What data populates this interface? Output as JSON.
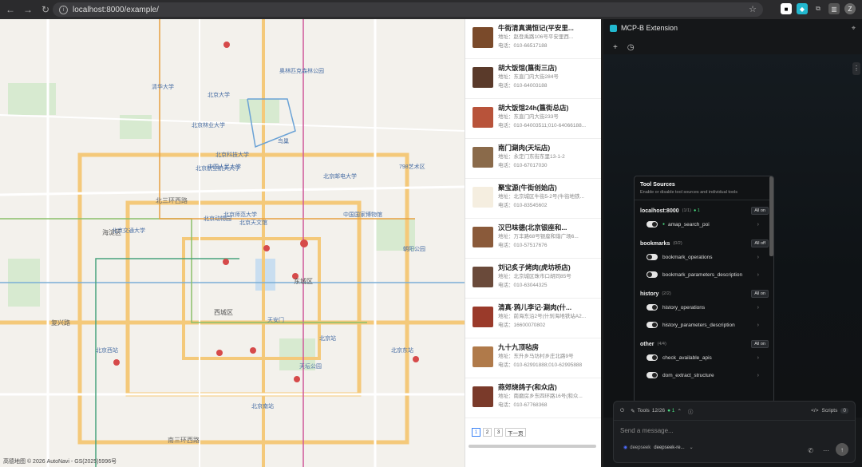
{
  "browser": {
    "url": "localhost:8000/example/",
    "profile_initial": "Z"
  },
  "map": {
    "labels": [
      {
        "text": "北京大学",
        "kind": "poi"
      },
      {
        "text": "清华大学",
        "kind": "poi"
      },
      {
        "text": "中国人民大学",
        "kind": "poi"
      },
      {
        "text": "北京师范大学",
        "kind": "poi"
      },
      {
        "text": "北京交通大学",
        "kind": "poi"
      },
      {
        "text": "北京科技大学",
        "kind": "poi"
      },
      {
        "text": "北京航空航天大学",
        "kind": "poi"
      },
      {
        "text": "北京林业大学",
        "kind": "poi"
      },
      {
        "text": "北京邮电大学",
        "kind": "poi"
      },
      {
        "text": "北京动物园",
        "kind": "poi"
      },
      {
        "text": "北京天文馆",
        "kind": "poi"
      },
      {
        "text": "中国国家博物馆",
        "kind": "poi"
      },
      {
        "text": "天安门",
        "kind": "poi"
      },
      {
        "text": "天坛公园",
        "kind": "poi"
      },
      {
        "text": "北京西站",
        "kind": "poi"
      },
      {
        "text": "北京南站",
        "kind": "poi"
      },
      {
        "text": "北京站",
        "kind": "poi"
      },
      {
        "text": "北京东站",
        "kind": "poi"
      },
      {
        "text": "朝阳公园",
        "kind": "poi"
      },
      {
        "text": "奥林匹克森林公园",
        "kind": "poi"
      },
      {
        "text": "西城区",
        "kind": "district"
      },
      {
        "text": "东城区",
        "kind": "district"
      },
      {
        "text": "海淀区",
        "kind": "district"
      },
      {
        "text": "复兴路",
        "kind": "road"
      },
      {
        "text": "北三环西路",
        "kind": "road"
      },
      {
        "text": "南三环西路",
        "kind": "road"
      },
      {
        "text": "鸟巢",
        "kind": "poi"
      },
      {
        "text": "798艺术区",
        "kind": "poi"
      }
    ],
    "attribution": "高德地图 © 2026 AutoNavi - GS(2025)5996号"
  },
  "results": {
    "address_prefix": "地址：",
    "phone_prefix": "电话：",
    "items": [
      {
        "name": "牛街清真满恒记(平安里...",
        "address": "赵登禹路106号平安里西...",
        "phone": "010-66517188"
      },
      {
        "name": "胡大饭馆(簋街三店)",
        "address": "东直门内大街284号",
        "phone": "010-64003188"
      },
      {
        "name": "胡大饭馆24h(簋街总店)",
        "address": "东直门内大街233号",
        "phone": "010-64003511;010-64066188..."
      },
      {
        "name": "南门涮肉(天坛店)",
        "address": "永定门东街东里13-1-2",
        "phone": "010-67017030"
      },
      {
        "name": "聚宝源(牛街创始店)",
        "address": "北京城区牛街5-2号(牛街地铁...",
        "phone": "010-83545602"
      },
      {
        "name": "汉巴味德(北京银座和...",
        "address": "万丰路68号银座和谐广场6...",
        "phone": "010-57517676"
      },
      {
        "name": "刘记炙子烤肉(虎坊桥店)",
        "address": "北京城区珠市口胡同85号",
        "phone": "010-63044325"
      },
      {
        "name": "清真·鸦儿李记·涮肉(什...",
        "address": "前海东沿2号(什刹海地铁站A2...",
        "phone": "16600070802"
      },
      {
        "name": "九十九顶毡房",
        "address": "东升乡马坊村乡庄北路9号",
        "phone": "010-62991888;010-62995888"
      },
      {
        "name": "燕郊烧鸽子(和众店)",
        "address": "南磨房乡东四环路16号(和众...",
        "phone": "010-67768368"
      }
    ],
    "pages": [
      "1",
      "2",
      "3"
    ],
    "next_label": "下一页"
  },
  "extension": {
    "title": "MCP-B Extension",
    "tool_sources": {
      "title": "Tool Sources",
      "subtitle": "Enable or disable tool sources and individual tools",
      "groups": [
        {
          "name": "localhost:8000",
          "count": "(1/1)",
          "live": "● 1",
          "action": "All on",
          "tools": [
            {
              "name": "amap_search_poi",
              "on": true,
              "dot": true
            }
          ]
        },
        {
          "name": "bookmarks",
          "count": "(0/2)",
          "live": "",
          "action": "All off",
          "tools": [
            {
              "name": "bookmark_operations",
              "on": false
            },
            {
              "name": "bookmark_parameters_description",
              "on": false
            }
          ]
        },
        {
          "name": "history",
          "count": "(2/2)",
          "live": "",
          "action": "All on",
          "tools": [
            {
              "name": "history_operations",
              "on": true
            },
            {
              "name": "history_parameters_description",
              "on": true
            }
          ]
        },
        {
          "name": "other",
          "count": "(4/4)",
          "live": "",
          "action": "All on",
          "tools": [
            {
              "name": "check_available_apis",
              "on": true
            },
            {
              "name": "dom_extract_structure",
              "on": true
            }
          ]
        }
      ]
    },
    "composer": {
      "tools_label": "Tools",
      "tools_count": "12/26",
      "tools_live": "● 1",
      "scripts_label": "Scripts",
      "scripts_count": "0",
      "placeholder": "Send a message...",
      "provider": "deepseek",
      "model": "deepseek-re..."
    }
  }
}
